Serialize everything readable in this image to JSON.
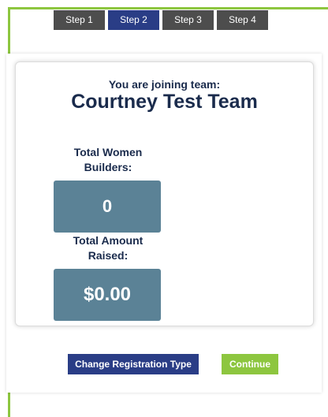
{
  "steps": [
    {
      "label": "Step 1",
      "active": false
    },
    {
      "label": "Step 2",
      "active": true
    },
    {
      "label": "Step 3",
      "active": false
    },
    {
      "label": "Step 4",
      "active": false
    }
  ],
  "team": {
    "joining_label": "You are joining team:",
    "name": "Courtney Test Team"
  },
  "stats": {
    "women_builders_label": "Total Women Builders:",
    "women_builders_value": "0",
    "amount_raised_label": "Total Amount Raised:",
    "amount_raised_value": "$0.00"
  },
  "actions": {
    "change_registration_label": "Change Registration Type",
    "continue_label": "Continue"
  },
  "colors": {
    "accent_green": "#8dc63f",
    "navy": "#2a3d86",
    "step_inactive": "#4d4d4d",
    "stat_box": "#5b8296",
    "heading_text": "#1a2b4c"
  }
}
